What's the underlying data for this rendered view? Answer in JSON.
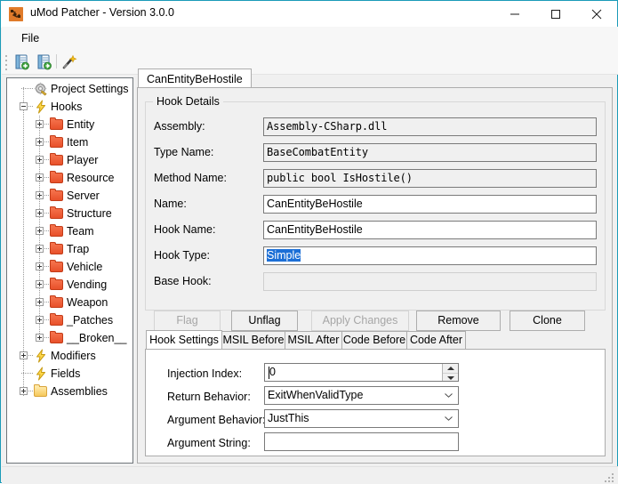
{
  "window": {
    "title": "uMod Patcher - Version 3.0.0",
    "icon": "app-icon",
    "border_color": "#1B9BB8",
    "controls": {
      "minimize": "minimize-icon",
      "maximize": "maximize-icon",
      "close": "close-icon"
    }
  },
  "menubar": {
    "items": [
      "File"
    ]
  },
  "toolbar": {
    "buttons": [
      {
        "name": "new-project-icon",
        "tooltip": "New"
      },
      {
        "name": "open-project-icon",
        "tooltip": "Open"
      },
      {
        "name": "magic-wand-icon",
        "tooltip": "Wand"
      }
    ]
  },
  "tree": {
    "nodes": [
      {
        "label": "Project Settings",
        "icon": "gear-icon",
        "depth": 1,
        "expander": "none"
      },
      {
        "label": "Hooks",
        "icon": "lightning-icon",
        "depth": 1,
        "expander": "minus"
      },
      {
        "label": "Entity",
        "icon": "folder-red",
        "depth": 2,
        "expander": "plus"
      },
      {
        "label": "Item",
        "icon": "folder-red",
        "depth": 2,
        "expander": "plus"
      },
      {
        "label": "Player",
        "icon": "folder-red",
        "depth": 2,
        "expander": "plus"
      },
      {
        "label": "Resource",
        "icon": "folder-red",
        "depth": 2,
        "expander": "plus"
      },
      {
        "label": "Server",
        "icon": "folder-red",
        "depth": 2,
        "expander": "plus"
      },
      {
        "label": "Structure",
        "icon": "folder-red",
        "depth": 2,
        "expander": "plus"
      },
      {
        "label": "Team",
        "icon": "folder-red",
        "depth": 2,
        "expander": "plus"
      },
      {
        "label": "Trap",
        "icon": "folder-red",
        "depth": 2,
        "expander": "plus"
      },
      {
        "label": "Vehicle",
        "icon": "folder-red",
        "depth": 2,
        "expander": "plus"
      },
      {
        "label": "Vending",
        "icon": "folder-red",
        "depth": 2,
        "expander": "plus"
      },
      {
        "label": "Weapon",
        "icon": "folder-red",
        "depth": 2,
        "expander": "plus"
      },
      {
        "label": "_Patches",
        "icon": "folder-red",
        "depth": 2,
        "expander": "plus"
      },
      {
        "label": "__Broken__",
        "icon": "folder-red",
        "depth": 2,
        "expander": "plus"
      },
      {
        "label": "Modifiers",
        "icon": "lightning-icon",
        "depth": 1,
        "expander": "plus"
      },
      {
        "label": "Fields",
        "icon": "lightning-icon",
        "depth": 1,
        "expander": "none"
      },
      {
        "label": "Assemblies",
        "icon": "folder-yellow",
        "depth": 1,
        "expander": "plus"
      }
    ]
  },
  "main_tab": {
    "label": "CanEntityBeHostile"
  },
  "hook_details": {
    "group_title": "Hook Details",
    "fields": [
      {
        "label": "Assembly:",
        "value": "Assembly-CSharp.dll",
        "mono": true,
        "readonly": true
      },
      {
        "label": "Type Name:",
        "value": "BaseCombatEntity",
        "mono": true,
        "readonly": true
      },
      {
        "label": "Method Name:",
        "value": "public bool IsHostile()",
        "mono": true,
        "readonly": true
      },
      {
        "label": "Name:",
        "value": "CanEntityBeHostile",
        "mono": false,
        "readonly": false
      },
      {
        "label": "Hook Name:",
        "value": "CanEntityBeHostile",
        "mono": false,
        "readonly": false
      },
      {
        "label": "Hook Type:",
        "value": "Simple",
        "mono": false,
        "readonly": false,
        "selected": true
      },
      {
        "label": "Base Hook:",
        "value": "",
        "mono": false,
        "readonly": true
      }
    ],
    "buttons": [
      {
        "label": "Flag",
        "enabled": false
      },
      {
        "label": "Unflag",
        "enabled": true
      },
      {
        "label": "Apply Changes",
        "enabled": false
      },
      {
        "label": "Remove",
        "enabled": true
      },
      {
        "label": "Clone",
        "enabled": true
      }
    ]
  },
  "bottom_tabs": {
    "tabs": [
      "Hook Settings",
      "MSIL Before",
      "MSIL After",
      "Code Before",
      "Code After"
    ],
    "active": "Hook Settings"
  },
  "hook_settings": {
    "injection_index": {
      "label": "Injection Index:",
      "value": "0"
    },
    "return_behavior": {
      "label": "Return Behavior:",
      "value": "ExitWhenValidType"
    },
    "argument_behavior": {
      "label": "Argument Behavior:",
      "value": "JustThis"
    },
    "argument_string": {
      "label": "Argument String:",
      "value": ""
    }
  },
  "colors": {
    "window_border": "#1B9BB8",
    "selection_blue": "#1C6FD6",
    "folder_red": "#E8502A",
    "app_icon_orange": "#E07B2A"
  }
}
